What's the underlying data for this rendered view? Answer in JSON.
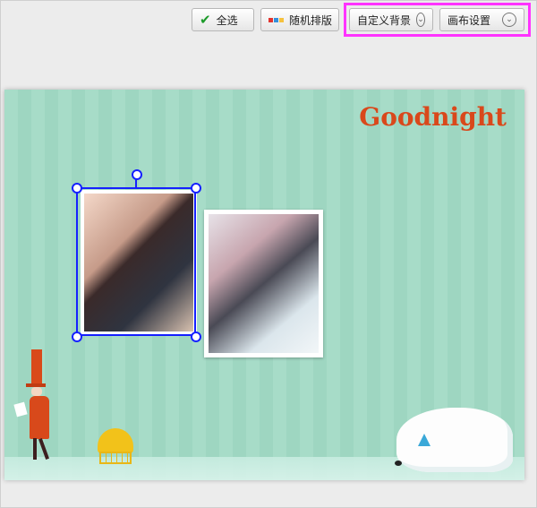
{
  "toolbar": {
    "select_all_label": "全选",
    "random_layout_label": "随机排版",
    "custom_background_label": "自定义背景",
    "canvas_settings_label": "画布设置"
  },
  "canvas": {
    "greeting_text": "Goodnight"
  },
  "icons": {
    "check": "check-icon",
    "layout": "layout-icon",
    "dropdown": "chevron-down-icon"
  },
  "colors": {
    "canvas_stripes": "#a7dcc8",
    "selection_border": "#1520ff",
    "highlight_box": "#ff33ff",
    "greeting": "#d9481b"
  }
}
